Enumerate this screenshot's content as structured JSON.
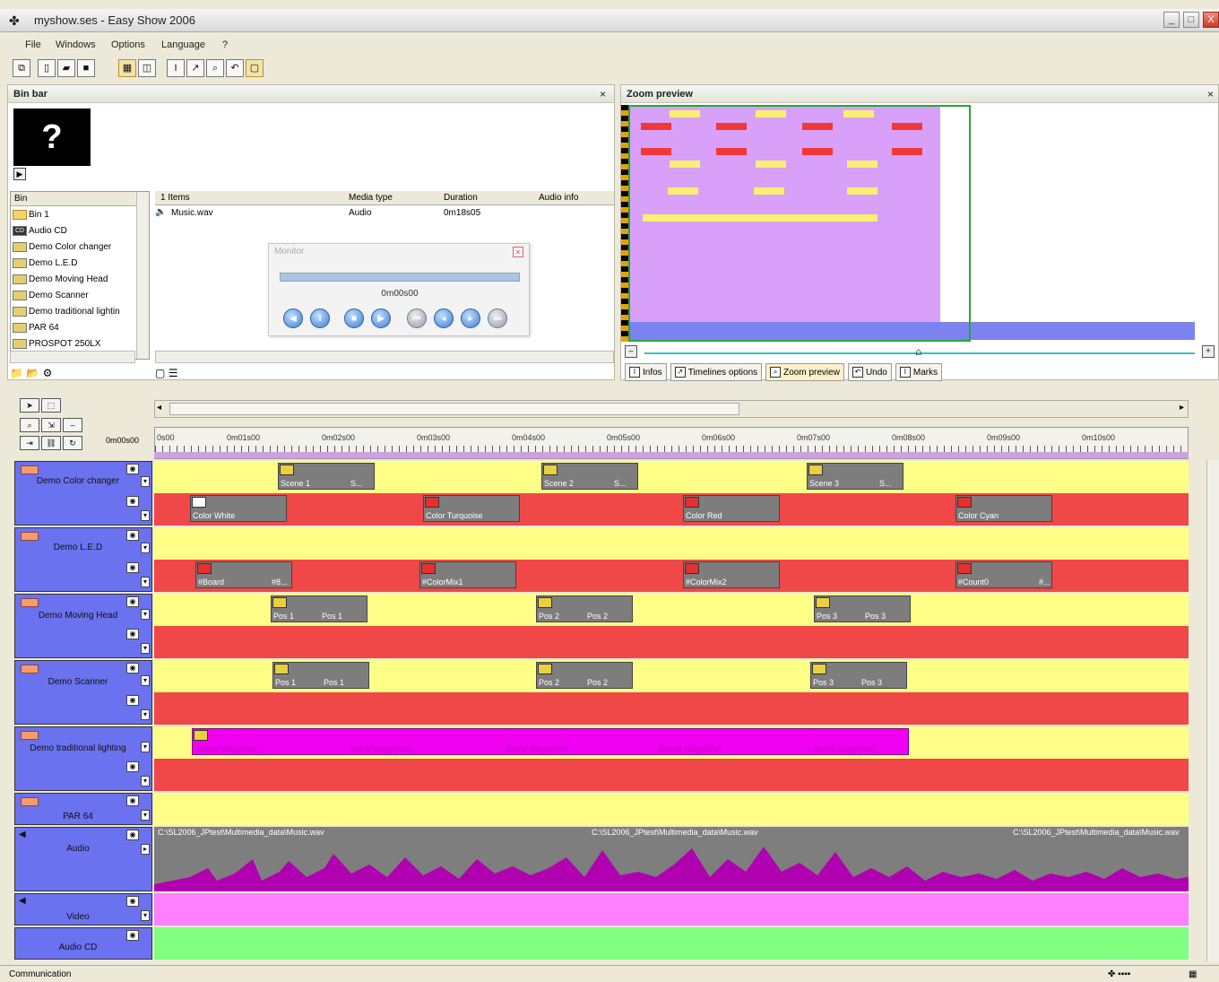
{
  "window": {
    "title": "myshow.ses - Easy Show 2006",
    "min": "_",
    "max": "□",
    "close": "X"
  },
  "menu": [
    "File",
    "Windows",
    "Options",
    "Language",
    "?"
  ],
  "bin_bar": {
    "title": "Bin bar",
    "close": "×",
    "preview_symbol": "?",
    "tree_header": "Bin",
    "tree_items": [
      "Bin 1",
      "Audio CD",
      "Demo Color changer",
      "Demo L.E.D",
      "Demo Moving Head",
      "Demo Scanner",
      "Demo traditional lightin",
      "PAR 64",
      "PROSPOT 250LX"
    ],
    "list_headers": [
      "1 Items",
      "Media type",
      "Duration",
      "Audio info"
    ],
    "rows": [
      {
        "name": "Music.wav",
        "type": "Audio",
        "duration": "0m18s05",
        "info": ""
      }
    ]
  },
  "monitor": {
    "title": "Monitor",
    "time": "0m00s00",
    "close": "×"
  },
  "zoom_preview": {
    "title": "Zoom preview",
    "close": "×",
    "tabs": [
      "Infos",
      "Timelines options",
      "Zoom preview",
      "Undo",
      "Marks"
    ]
  },
  "ruler": {
    "start": "0m00s00",
    "ticks": [
      "0s00",
      "0m01s00",
      "0m02s00",
      "0m03s00",
      "0m04s00",
      "0m05s00",
      "0m06s00",
      "0m07s00",
      "0m08s00",
      "0m09s00",
      "0m10s00"
    ]
  },
  "tracks": [
    {
      "name": "Demo Color changer",
      "clips_top": [
        "Scene 1",
        "S...",
        "Scene 2",
        "S...",
        "Scene 3",
        "S..."
      ],
      "clips_bottom": [
        "Color White",
        "Color Turquoise",
        "Color Red",
        "Color Cyan"
      ]
    },
    {
      "name": "Demo L.E.D",
      "clips_bottom": [
        "#Board",
        "#8...",
        "#ColorMix1",
        "#ColorMix2",
        "#Count0",
        "#..."
      ]
    },
    {
      "name": "Demo Moving Head",
      "clips_top": [
        "Pos 1",
        "Pos 1",
        "Pos 2",
        "Pos 2",
        "Pos 3",
        "Pos 3"
      ]
    },
    {
      "name": "Demo Scanner",
      "clips_top": [
        "Pos 1",
        "Pos 1",
        "Pos 2",
        "Pos 2",
        "Pos 3",
        "Pos 3"
      ]
    },
    {
      "name": "Demo traditional lighting",
      "clips_top": [
        "Scene stage(line)",
        "Scene stage(line)",
        "Scene stage(line)",
        "Scene stage(line)",
        "Scene stage(line)"
      ]
    },
    {
      "name": "PAR 64"
    },
    {
      "name": "Audio",
      "path": "C:\\SL2006_JPtest\\Multimedia_data\\Music.wav"
    },
    {
      "name": "Video"
    },
    {
      "name": "Audio CD"
    }
  ],
  "status": {
    "left": "Communication"
  }
}
